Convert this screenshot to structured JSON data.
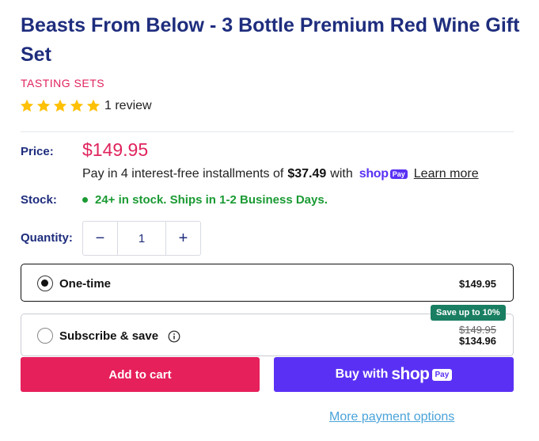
{
  "product": {
    "title": "Beasts From Below - 3 Bottle Premium Red Wine Gift Set",
    "vendor": "TASTING SETS",
    "rating": {
      "stars": 5,
      "review_text": "1 review",
      "star_color": "#ffc107"
    }
  },
  "pricing": {
    "price_label": "Price:",
    "price": "$149.95",
    "installments_prefix": "Pay in 4 interest-free installments of",
    "installment_amount": "$37.49",
    "installments_with": "with",
    "shop_word": "shop",
    "pay_word": "Pay",
    "learn_more": "Learn more"
  },
  "stock": {
    "label": "Stock:",
    "text": "24+ in stock. Ships in 1-2 Business Days.",
    "color": "#1a9a33"
  },
  "quantity": {
    "label": "Quantity:",
    "value": "1",
    "minus": "−",
    "plus": "+"
  },
  "purchase_options": {
    "one_time": {
      "label": "One-time",
      "price": "$149.95",
      "selected": true
    },
    "subscribe": {
      "label": "Subscribe & save",
      "badge": "Save up to 10%",
      "original_price": "$149.95",
      "price": "$134.96",
      "selected": false
    }
  },
  "actions": {
    "add_to_cart": "Add to cart",
    "buy_with": "Buy with",
    "buy_shop": "shop",
    "buy_pay": "Pay",
    "more_payment_options": "More payment options"
  },
  "colors": {
    "brand_blue": "#1e2d7d",
    "accent_pink": "#e0245e",
    "shop_pay_purple": "#5a31f4",
    "badge_green": "#1a7f62",
    "link_blue": "#4aa3d9"
  }
}
